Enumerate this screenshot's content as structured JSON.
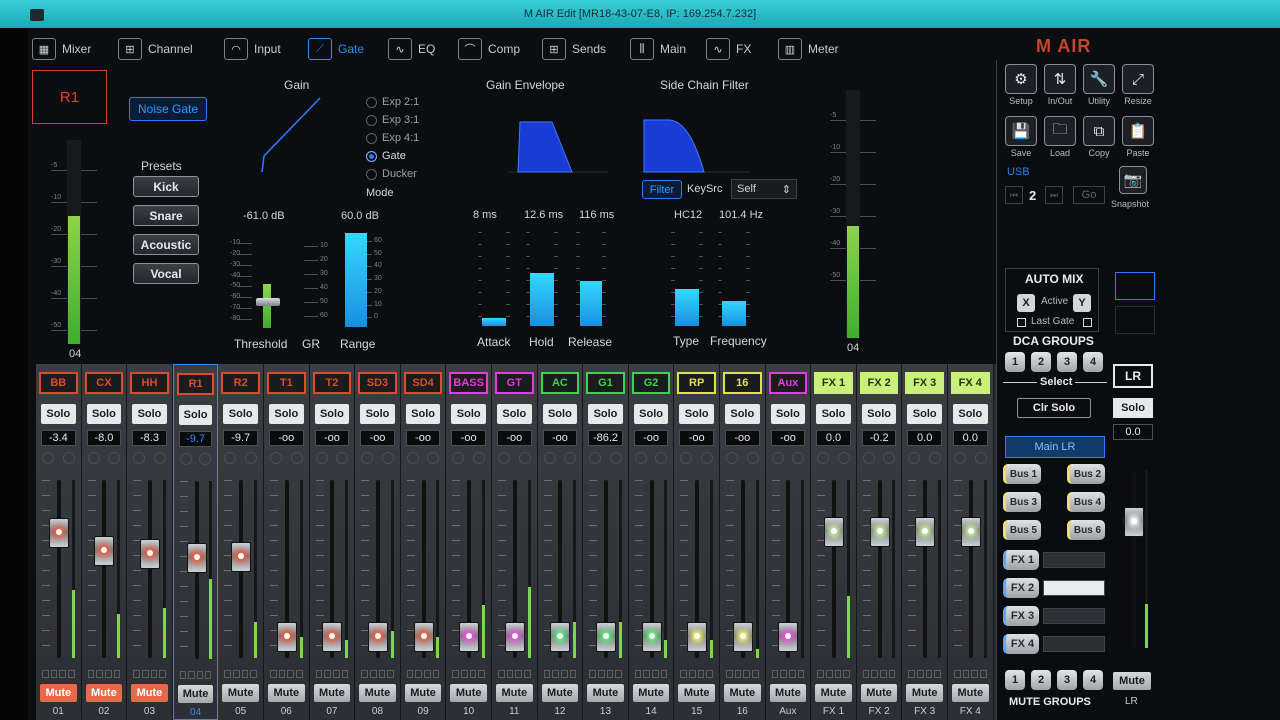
{
  "window": {
    "title": "M AIR Edit [MR18-43-07-E8, IP: 169.254.7.232]"
  },
  "nav": [
    {
      "label": "Mixer",
      "icon": "mixer-icon",
      "glyph": "▦"
    },
    {
      "label": "Channel",
      "icon": "channel-icon",
      "glyph": "⊞"
    },
    {
      "label": "Input",
      "icon": "input-icon",
      "glyph": "◠"
    },
    {
      "label": "Gate",
      "icon": "gate-icon",
      "glyph": "⟋",
      "active": true
    },
    {
      "label": "EQ",
      "icon": "eq-icon",
      "glyph": "∿"
    },
    {
      "label": "Comp",
      "icon": "comp-icon",
      "glyph": "⌒"
    },
    {
      "label": "Sends",
      "icon": "sends-icon",
      "glyph": "⊞"
    },
    {
      "label": "Main",
      "icon": "main-icon",
      "glyph": "⫼"
    },
    {
      "label": "FX",
      "icon": "fx-icon",
      "glyph": "∿"
    },
    {
      "label": "Meter",
      "icon": "meter-icon",
      "glyph": "▥"
    }
  ],
  "logo": "M AIR",
  "gate": {
    "channel": "R1",
    "noise_gate": "Noise Gate",
    "presets_label": "Presets",
    "presets": [
      "Kick",
      "Snare",
      "Acoustic",
      "Vocal"
    ],
    "gain_label": "Gain",
    "modes": [
      "Exp 2:1",
      "Exp 3:1",
      "Exp 4:1",
      "Gate",
      "Ducker"
    ],
    "mode_selected": "Gate",
    "mode_label": "Mode",
    "threshold_value": "-61.0 dB",
    "range_value": "60.0 dB",
    "threshold_label": "Threshold",
    "gr_label": "GR",
    "range_label": "Range",
    "envelope_label": "Gain Envelope",
    "attack_value": "8 ms",
    "hold_value": "12.6 ms",
    "release_value": "116 ms",
    "attack_label": "Attack",
    "hold_label": "Hold",
    "release_label": "Release",
    "sidechain_label": "Side Chain Filter",
    "filter_btn": "Filter",
    "keysrc_label": "KeySrc",
    "keysrc_value": "Self",
    "type_value": "HC12",
    "freq_value": "101.4 Hz",
    "type_label": "Type",
    "freq_label": "Frequency",
    "meter_left_label": "04",
    "meter_right_label": "04",
    "threshold_scale": [
      "-10",
      "-20",
      "-30",
      "-40",
      "-50",
      "-60",
      "-70",
      "-80"
    ],
    "gr_scale": [
      "10",
      "20",
      "30",
      "40",
      "50",
      "60"
    ],
    "range_scale": [
      "60",
      "50",
      "40",
      "30",
      "20",
      "10",
      "0"
    ],
    "meter_scale": [
      "-5",
      "-10",
      "-20",
      "-30",
      "-40",
      "-50"
    ]
  },
  "utility": {
    "row1": [
      {
        "label": "Setup",
        "icon": "gear-icon",
        "glyph": "⚙"
      },
      {
        "label": "In/Out",
        "icon": "inout-icon",
        "glyph": "⇅"
      },
      {
        "label": "Utility",
        "icon": "wrench-icon",
        "glyph": "🔧"
      },
      {
        "label": "Resize",
        "icon": "resize-icon",
        "glyph": "⤢"
      }
    ],
    "row2": [
      {
        "label": "Save",
        "icon": "save-icon",
        "glyph": "💾"
      },
      {
        "label": "Load",
        "icon": "folder-icon",
        "glyph": "🗀"
      },
      {
        "label": "Copy",
        "icon": "copy-icon",
        "glyph": "⧉"
      },
      {
        "label": "Paste",
        "icon": "paste-icon",
        "glyph": "📋"
      }
    ],
    "usb": "USB",
    "usb_num": "2",
    "go": "Go",
    "snapshot": "Snapshot",
    "automix": "AUTO MIX",
    "active": "Active",
    "x": "X",
    "y": "Y",
    "last_gate": "Last Gate",
    "dca_groups": "DCA GROUPS",
    "dca": [
      "1",
      "2",
      "3",
      "4"
    ],
    "select": "Select",
    "clr_solo": "Clr Solo",
    "main_lr": "Main LR",
    "buses": [
      "Bus 1",
      "Bus 2",
      "Bus 3",
      "Bus 4",
      "Bus 5",
      "Bus 6"
    ],
    "fx": [
      "FX 1",
      "FX 2",
      "FX 3",
      "FX 4"
    ],
    "mute_groups": "MUTE GROUPS",
    "mute": [
      "1",
      "2",
      "3",
      "4"
    ],
    "lr_name": "LR",
    "lr_solo": "Solo",
    "lr_value": "0.0",
    "lr_mute": "Mute",
    "lr_num": "LR"
  },
  "strip_labels": {
    "solo": "Solo",
    "mute": "Mute"
  },
  "channels": [
    {
      "name": "BB",
      "color": "#e04a2c",
      "value": "-3.4",
      "num": "01",
      "muted": true,
      "fader": 0.74,
      "level": 0.38,
      "led": "#ff5533"
    },
    {
      "name": "CX",
      "color": "#e04a2c",
      "value": "-8.0",
      "num": "02",
      "muted": true,
      "fader": 0.62,
      "level": 0.25,
      "led": "#ff5533"
    },
    {
      "name": "HH",
      "color": "#e04a2c",
      "value": "-8.3",
      "num": "03",
      "muted": true,
      "fader": 0.6,
      "level": 0.28,
      "led": "#ff5533"
    },
    {
      "name": "R1",
      "color": "#e04a2c",
      "value": "-9.7",
      "num": "04",
      "muted": false,
      "fader": 0.58,
      "level": 0.45,
      "led": "#ff5533",
      "sel": true
    },
    {
      "name": "R2",
      "color": "#e04a2c",
      "value": "-9.7",
      "num": "05",
      "muted": false,
      "fader": 0.58,
      "level": 0.2,
      "led": "#ff5533"
    },
    {
      "name": "T1",
      "color": "#e04a2c",
      "value": "-oo",
      "num": "06",
      "muted": false,
      "fader": 0.04,
      "level": 0.12,
      "led": "#ff5533"
    },
    {
      "name": "T2",
      "color": "#e04a2c",
      "value": "-oo",
      "num": "07",
      "muted": false,
      "fader": 0.04,
      "level": 0.1,
      "led": "#ff5533"
    },
    {
      "name": "SD3",
      "color": "#e04a2c",
      "value": "-oo",
      "num": "08",
      "muted": false,
      "fader": 0.04,
      "level": 0.15,
      "led": "#ff5533"
    },
    {
      "name": "SD4",
      "color": "#e04a2c",
      "value": "-oo",
      "num": "09",
      "muted": false,
      "fader": 0.04,
      "level": 0.12,
      "led": "#ff5533"
    },
    {
      "name": "BASS",
      "color": "#e43adf",
      "value": "-oo",
      "num": "10",
      "muted": false,
      "fader": 0.04,
      "level": 0.3,
      "led": "#ff44ee"
    },
    {
      "name": "GT",
      "color": "#e43adf",
      "value": "-oo",
      "num": "11",
      "muted": false,
      "fader": 0.04,
      "level": 0.4,
      "led": "#ff44ee"
    },
    {
      "name": "AC",
      "color": "#3fd050",
      "value": "-oo",
      "num": "12",
      "muted": false,
      "fader": 0.04,
      "level": 0.2,
      "led": "#55ff77"
    },
    {
      "name": "G1",
      "color": "#3fd050",
      "value": "-86.2",
      "num": "13",
      "muted": false,
      "fader": 0.04,
      "level": 0.2,
      "led": "#55ff77"
    },
    {
      "name": "G2",
      "color": "#3fd050",
      "value": "-oo",
      "num": "14",
      "muted": false,
      "fader": 0.04,
      "level": 0.1,
      "led": "#55ff77"
    },
    {
      "name": "RP",
      "color": "#e0e04a",
      "value": "-oo",
      "num": "15",
      "muted": false,
      "fader": 0.04,
      "level": 0.1,
      "led": "#ffff66"
    },
    {
      "name": "16",
      "color": "#e0e04a",
      "value": "-oo",
      "num": "16",
      "muted": false,
      "fader": 0.04,
      "level": 0.05,
      "led": "#ffff66"
    },
    {
      "name": "Aux",
      "color": "#e43adf",
      "value": "-oo",
      "num": "Aux",
      "muted": false,
      "fader": 0.04,
      "level": 0.0,
      "led": "#ff44ee"
    },
    {
      "name": "FX 1",
      "color": "#c8f07a",
      "value": "0.0",
      "num": "FX 1",
      "muted": false,
      "fader": 0.75,
      "level": 0.35,
      "led": "#ccff99",
      "fx": true
    },
    {
      "name": "FX 2",
      "color": "#c8f07a",
      "value": "-0.2",
      "num": "FX 2",
      "muted": false,
      "fader": 0.75,
      "level": 0.0,
      "led": "#ccff99",
      "fx": true
    },
    {
      "name": "FX 3",
      "color": "#c8f07a",
      "value": "0.0",
      "num": "FX 3",
      "muted": false,
      "fader": 0.75,
      "level": 0.0,
      "led": "#ccff99",
      "fx": true
    },
    {
      "name": "FX 4",
      "color": "#c8f07a",
      "value": "0.0",
      "num": "FX 4",
      "muted": false,
      "fader": 0.75,
      "level": 0.0,
      "led": "#ccff99",
      "fx": true
    }
  ],
  "lr": {
    "fader": 0.75,
    "level": 0.25
  }
}
